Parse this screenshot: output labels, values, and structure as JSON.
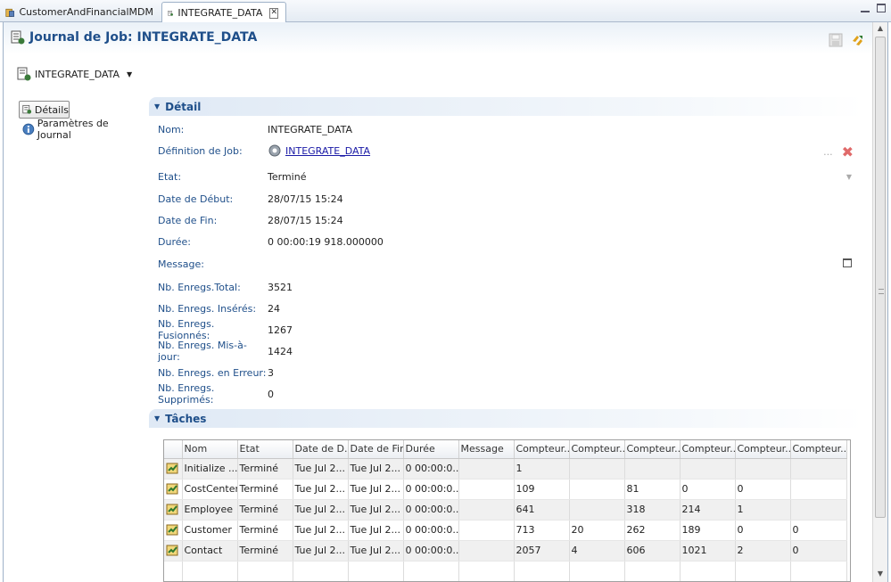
{
  "tabs": [
    {
      "label": "CustomerAndFinancialMDM",
      "active": false
    },
    {
      "label": "INTEGRATE_DATA",
      "active": true
    }
  ],
  "header": {
    "title": "Journal de Job: INTEGRATE_DATA"
  },
  "job_selector": {
    "value": "INTEGRATE_DATA"
  },
  "nav": {
    "items": [
      {
        "label": "Détails",
        "selected": true
      },
      {
        "label": "Paramètres de Journal",
        "selected": false
      }
    ]
  },
  "detail": {
    "section_title": "Détail",
    "fields": [
      {
        "label": "Nom:",
        "value": "INTEGRATE_DATA"
      },
      {
        "label": "Définition de Job:",
        "value": "INTEGRATE_DATA"
      },
      {
        "label": "Etat:",
        "value": "Terminé"
      },
      {
        "label": "Date de Début:",
        "value": "28/07/15 15:24"
      },
      {
        "label": "Date de Fin:",
        "value": "28/07/15 15:24"
      },
      {
        "label": "Durée:",
        "value": "0 00:00:19 918.000000"
      },
      {
        "label": "Message:",
        "value": ""
      },
      {
        "label": "Nb. Enregs.Total:",
        "value": "3521"
      },
      {
        "label": "Nb. Enregs. Insérés:",
        "value": "24"
      },
      {
        "label": "Nb. Enregs. Fusionnés:",
        "value": "1267"
      },
      {
        "label": "Nb. Enregs. Mis-à-jour:",
        "value": "1424"
      },
      {
        "label": "Nb. Enregs. en Erreur:",
        "value": "3"
      },
      {
        "label": "Nb. Enregs. Supprimés:",
        "value": "0"
      }
    ],
    "job_def_more": "..."
  },
  "tasks": {
    "section_title": "Tâches",
    "columns": [
      "",
      "Nom",
      "Etat",
      "Date de D...",
      "Date de Fin",
      "Durée",
      "Message",
      "Compteur...",
      "Compteur...",
      "Compteur...",
      "Compteur...",
      "Compteur...",
      "Compteur..."
    ],
    "rows": [
      [
        "",
        "Initialize ...",
        "Terminé",
        "Tue Jul 2...",
        "Tue Jul 2...",
        "0 00:00:0...",
        "",
        "1",
        "",
        "",
        "",
        "",
        ""
      ],
      [
        "",
        "CostCenter",
        "Terminé",
        "Tue Jul 2...",
        "Tue Jul 2...",
        "0 00:00:0...",
        "",
        "109",
        "",
        "81",
        "0",
        "0",
        ""
      ],
      [
        "",
        "Employee",
        "Terminé",
        "Tue Jul 2...",
        "Tue Jul 2...",
        "0 00:00:0...",
        "",
        "641",
        "",
        "318",
        "214",
        "1",
        ""
      ],
      [
        "",
        "Customer",
        "Terminé",
        "Tue Jul 2...",
        "Tue Jul 2...",
        "0 00:00:0...",
        "",
        "713",
        "20",
        "262",
        "189",
        "0",
        "0"
      ],
      [
        "",
        "Contact",
        "Terminé",
        "Tue Jul 2...",
        "Tue Jul 2...",
        "0 00:00:0...",
        "",
        "2057",
        "4",
        "606",
        "1021",
        "2",
        "0"
      ]
    ]
  },
  "colors": {
    "accent": "#1f4f8a",
    "link": "#1a1aa6",
    "delete": "#e06a6a"
  }
}
